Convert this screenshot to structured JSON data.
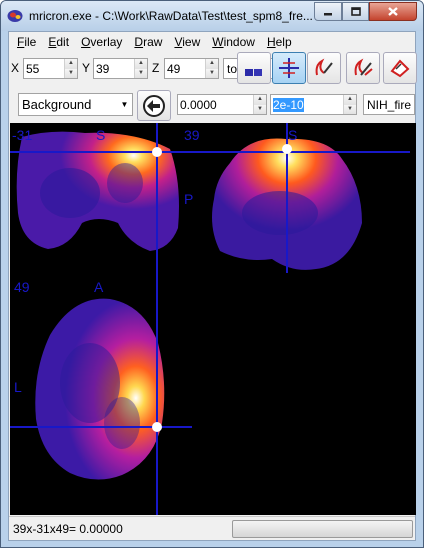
{
  "window": {
    "title": "mricron.exe - C:\\Work\\RawData\\Test\\test_spm8_fre...",
    "controls": {
      "minimize": "minimize-icon",
      "maximize": "maximize-icon",
      "close": "close-icon"
    }
  },
  "menu": {
    "items": [
      {
        "key": "F",
        "rest": "ile"
      },
      {
        "key": "E",
        "rest": "dit"
      },
      {
        "key": "O",
        "rest": "verlay"
      },
      {
        "key": "D",
        "rest": "raw"
      },
      {
        "key": "V",
        "rest": "iew"
      },
      {
        "key": "W",
        "rest": "indow"
      },
      {
        "key": "H",
        "rest": "elp"
      }
    ]
  },
  "toolbar": {
    "x_label": "X",
    "x_value": "55",
    "y_label": "Y",
    "y_value": "39",
    "z_label": "Z",
    "z_value": "49",
    "zoom_value": "to fit",
    "layer_value": "Background",
    "min_value": "0.0000",
    "max_value": "2e-10",
    "colormap_value": "NIH_fire",
    "tools": [
      "multislice-view-icon",
      "crosshair-icon",
      "pen-draw-icon",
      "pen-erase-icon",
      "fill-icon"
    ],
    "back_button_icon": "arrow-left-icon"
  },
  "viewer": {
    "coronal_label": "-31",
    "coronal_top": "S",
    "sagittal_label": "39",
    "sagittal_top": "S",
    "sagittal_side": "P",
    "axial_label": "49",
    "axial_top": "A",
    "axial_side": "L"
  },
  "status": {
    "text": "39x-31x49= 0.00000"
  },
  "colors": {
    "background": "#000000",
    "crosshair": "#1818c8",
    "label": "#1818c8"
  }
}
